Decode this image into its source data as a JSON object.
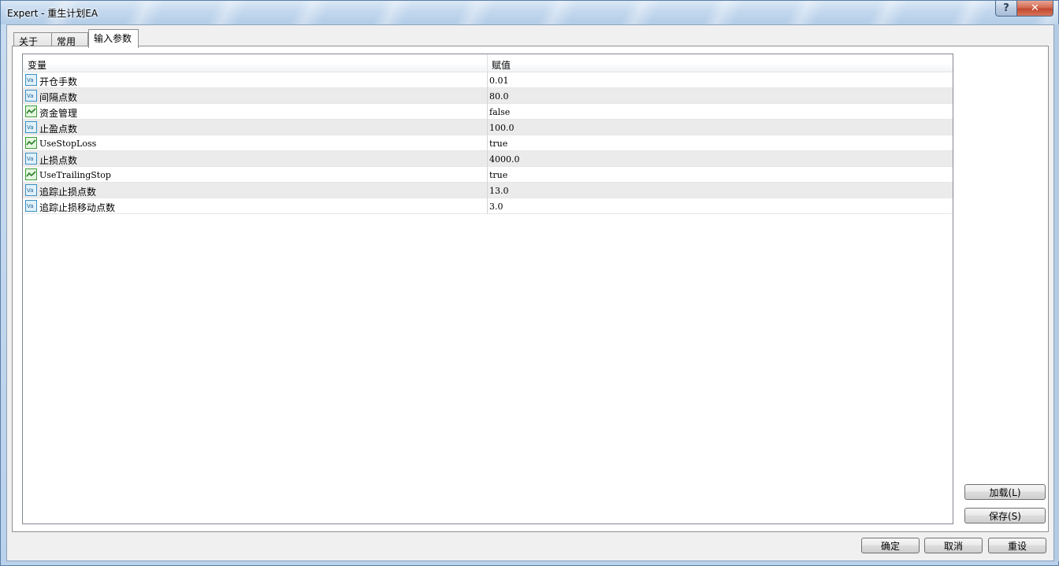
{
  "window": {
    "title": "Expert - 重生计划EA",
    "help_label": "?",
    "close_label": "✕"
  },
  "tabs": [
    {
      "label": "关于",
      "active": false
    },
    {
      "label": "常用",
      "active": false
    },
    {
      "label": "输入参数",
      "active": true
    }
  ],
  "grid": {
    "columns": [
      "变量",
      "赋值"
    ],
    "rows": [
      {
        "name": "开仓手数",
        "value": "0.01",
        "icon": "number-variable-icon"
      },
      {
        "name": "间隔点数",
        "value": "80.0",
        "icon": "number-variable-icon"
      },
      {
        "name": "资金管理",
        "value": "false",
        "icon": "boolean-variable-icon"
      },
      {
        "name": "止盈点数",
        "value": "100.0",
        "icon": "number-variable-icon"
      },
      {
        "name": "UseStopLoss",
        "value": "true",
        "icon": "boolean-variable-icon"
      },
      {
        "name": "止损点数",
        "value": "4000.0",
        "icon": "number-variable-icon"
      },
      {
        "name": "UseTrailingStop",
        "value": "true",
        "icon": "boolean-variable-icon"
      },
      {
        "name": "追踪止损点数",
        "value": "13.0",
        "icon": "number-variable-icon"
      },
      {
        "name": "追踪止损移动点数",
        "value": "3.0",
        "icon": "number-variable-icon"
      }
    ]
  },
  "side_buttons": {
    "load": "加载(L)",
    "save": "保存(S)"
  },
  "bottom_buttons": {
    "ok": "确定",
    "cancel": "取消",
    "reset": "重设"
  },
  "colors": {
    "row_alt": "#ebebeb",
    "title_bar": "#c3d8ee",
    "close_button": "#c24a2f"
  }
}
